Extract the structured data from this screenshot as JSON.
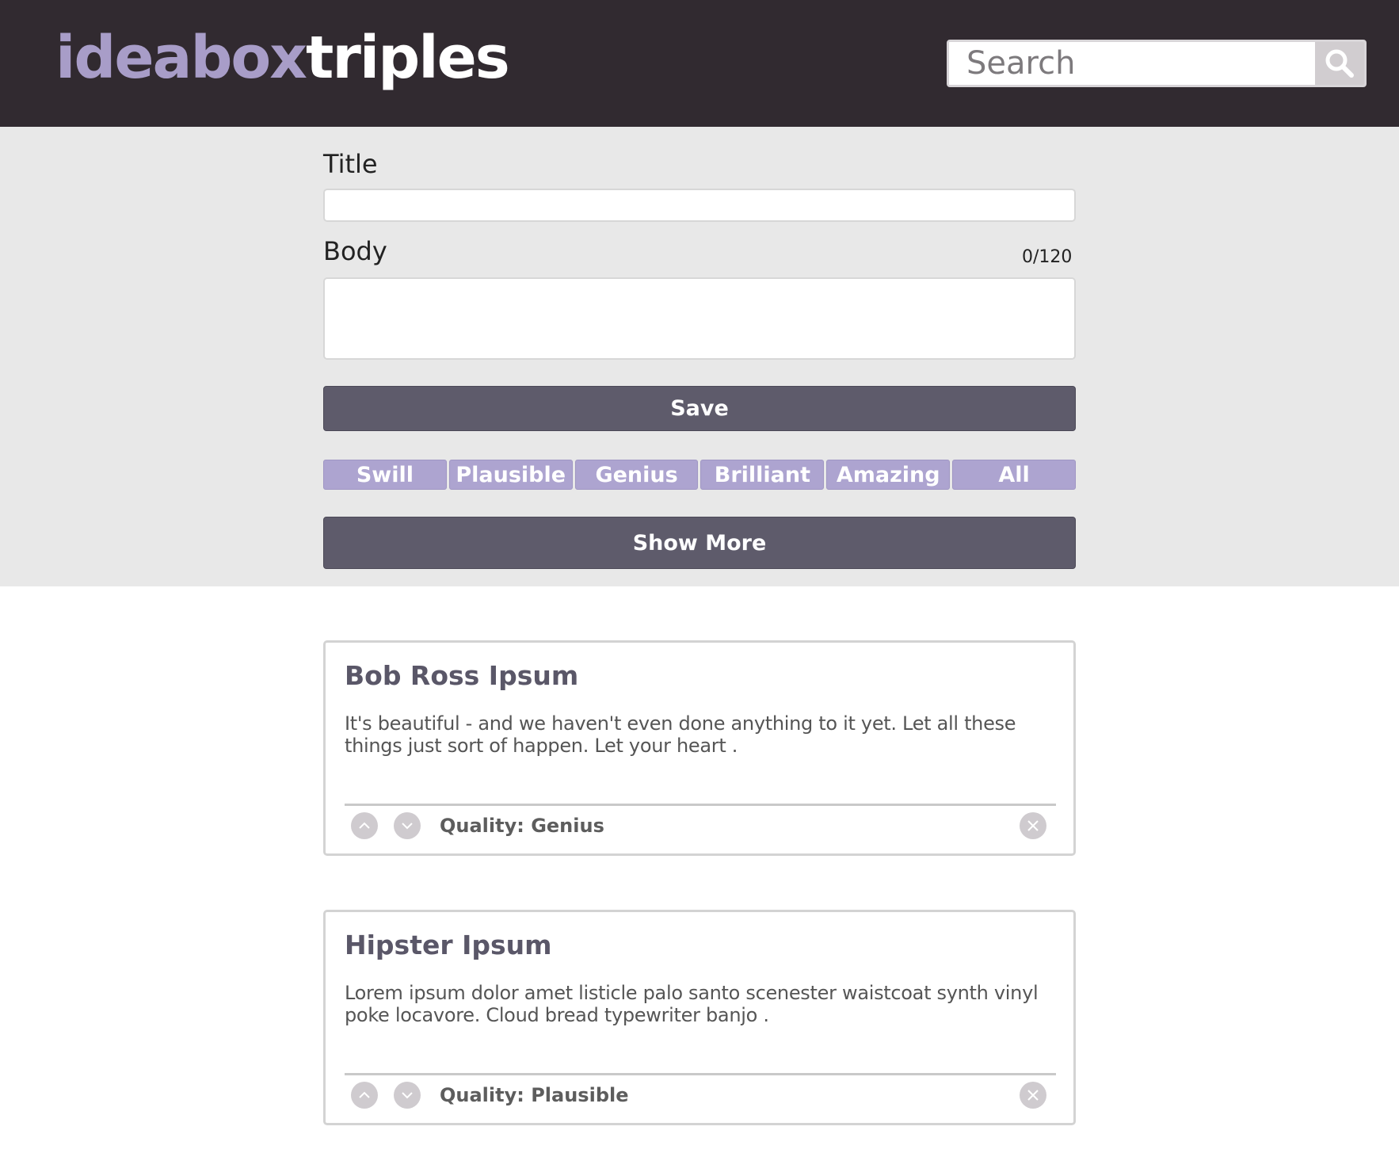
{
  "header": {
    "logo_part1": "ideabox",
    "logo_part2": "triples",
    "search_placeholder": "Search",
    "search_icon": "search-icon"
  },
  "form": {
    "title_label": "Title",
    "body_label": "Body",
    "char_counter": "0/120",
    "save_label": "Save",
    "filters": [
      "Swill",
      "Plausible",
      "Genius",
      "Brilliant",
      "Amazing",
      "All"
    ],
    "show_more_label": "Show More"
  },
  "ideas": [
    {
      "title": "Bob Ross Ipsum",
      "body": "It's beautiful - and we haven't even done anything to it yet. Let all these things just sort of happen. Let your heart .",
      "quality": "Quality: Genius"
    },
    {
      "title": "Hipster Ipsum",
      "body": "Lorem ipsum dolor amet listicle palo santo scenester waistcoat synth vinyl poke locavore. Cloud bread typewriter banjo .",
      "quality": "Quality: Plausible"
    }
  ],
  "colors": {
    "header_bg": "#312a30",
    "logo_accent": "#a89dc8",
    "button_dark": "#5e5b6b",
    "filter_bg": "#ada4d0",
    "form_bg": "#e8e8e8"
  }
}
